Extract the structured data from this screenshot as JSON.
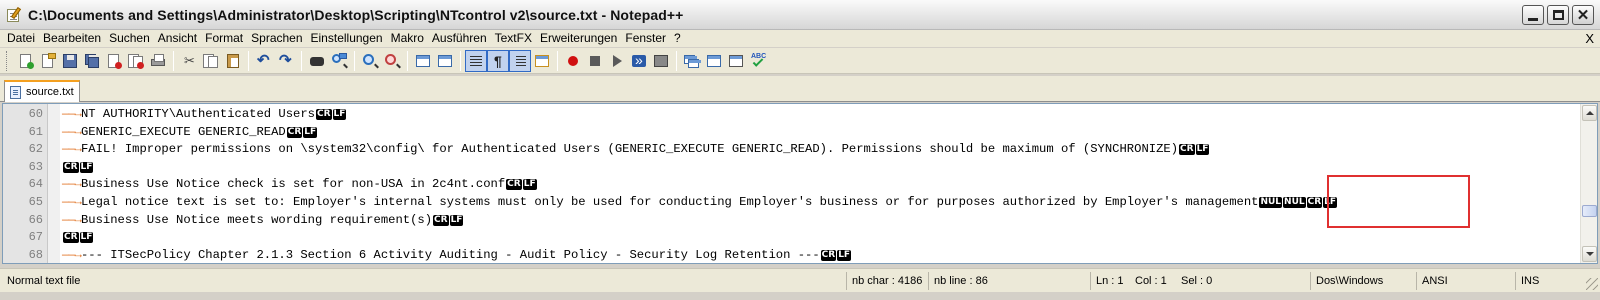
{
  "window": {
    "title": "C:\\Documents and Settings\\Administrator\\Desktop\\Scripting\\NTcontrol v2\\source.txt - Notepad++"
  },
  "menu": {
    "items": [
      "Datei",
      "Bearbeiten",
      "Suchen",
      "Ansicht",
      "Format",
      "Sprachen",
      "Einstellungen",
      "Makro",
      "Ausführen",
      "TextFX",
      "Erweiterungen",
      "Fenster",
      "?"
    ],
    "close_glyph": "X"
  },
  "toolbar": {
    "buttons": [
      "new-file",
      "open-file",
      "save",
      "save-all",
      "close",
      "close-all",
      "print",
      "cut",
      "copy",
      "paste",
      "undo",
      "redo",
      "find",
      "replace",
      "zoom-in",
      "zoom-out",
      "sync-vertical",
      "sync-horizontal",
      "word-wrap",
      "show-all-characters",
      "indent-guide",
      "user-defined-dialog",
      "record-macro",
      "stop-recording",
      "playback-macro",
      "run-macro-multiple",
      "save-macro",
      "tool-1",
      "tool-2",
      "tool-3",
      "spell-check"
    ],
    "pressed": [
      "word-wrap",
      "show-all-characters",
      "indent-guide"
    ]
  },
  "tabs": [
    {
      "label": "source.txt",
      "active": true
    }
  ],
  "editor": {
    "tab_arrow": "——→",
    "lines": [
      {
        "num": "60",
        "tab": true,
        "text": "NT AUTHORITY\\Authenticated Users",
        "controls": [
          "CR",
          "LF"
        ]
      },
      {
        "num": "61",
        "tab": true,
        "text": "GENERIC_EXECUTE GENERIC_READ",
        "controls": [
          "CR",
          "LF"
        ]
      },
      {
        "num": "62",
        "tab": true,
        "text": "FAIL! Improper permissions on \\system32\\config\\ for Authenticated Users (GENERIC_EXECUTE GENERIC_READ). Permissions should be maximum of (SYNCHRONIZE)",
        "controls": [
          "CR",
          "LF"
        ]
      },
      {
        "num": "63",
        "tab": false,
        "text": "",
        "controls": [
          "CR",
          "LF"
        ]
      },
      {
        "num": "64",
        "tab": true,
        "text": "Business Use Notice check is set for non-USA in 2c4nt.conf",
        "controls": [
          "CR",
          "LF"
        ]
      },
      {
        "num": "65",
        "tab": true,
        "text": "Legal notice text is set to: Employer's internal systems must only be used for conducting Employer's business or for purposes authorized by Employer's management",
        "controls": [
          "NUL",
          "NUL",
          "CR",
          "LF"
        ]
      },
      {
        "num": "66",
        "tab": true,
        "text": "Business Use Notice meets wording requirement(s)",
        "controls": [
          "CR",
          "LF"
        ]
      },
      {
        "num": "67",
        "tab": false,
        "text": "",
        "controls": [
          "CR",
          "LF"
        ]
      },
      {
        "num": "68",
        "tab": true,
        "text": "--- ITSecPolicy Chapter 2.1.3 Section 6 Activity Auditing - Audit Policy - Security Log Retention ---",
        "controls": [
          "CR",
          "LF"
        ]
      }
    ]
  },
  "status": {
    "file_type": "Normal text file",
    "nb_char": "nb char : 4186",
    "nb_line": "nb line : 86",
    "ln": "Ln : 1",
    "col": "Col : 1",
    "sel": "Sel : 0",
    "eol": "Dos\\Windows",
    "encoding": "ANSI",
    "mode": "INS"
  }
}
